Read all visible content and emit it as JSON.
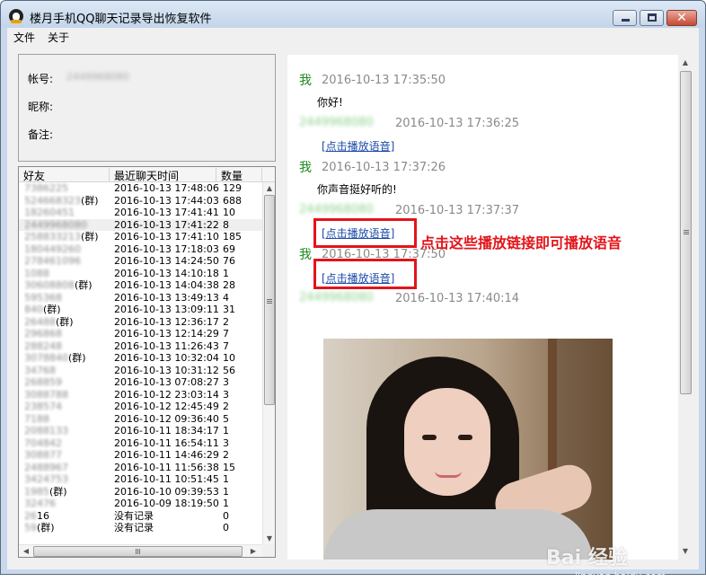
{
  "window": {
    "title": "楼月手机QQ聊天记录导出恢复软件"
  },
  "menu": {
    "file": "文件",
    "about": "关于"
  },
  "info": {
    "account_label": "帐号:",
    "account_value": "2449968080",
    "nickname_label": "昵称:",
    "note_label": "备注:"
  },
  "friends": {
    "headers": {
      "friend": "好友",
      "time": "最近聊天时间",
      "count": "数量"
    },
    "rows": [
      {
        "friend": "7386225",
        "group": "",
        "time": "2016-10-13 17:48:06",
        "count": "129"
      },
      {
        "friend": "524668323",
        "group": "(群)",
        "time": "2016-10-13 17:44:03",
        "count": "688"
      },
      {
        "friend": "18260451",
        "group": "",
        "time": "2016-10-13 17:41:41",
        "count": "10"
      },
      {
        "friend": "2449968080",
        "group": "",
        "time": "2016-10-13 17:41:22",
        "count": "8"
      },
      {
        "friend": "258833213",
        "group": "(群)",
        "time": "2016-10-13 17:41:10",
        "count": "185"
      },
      {
        "friend": "180449260",
        "group": "",
        "time": "2016-10-13 17:18:03",
        "count": "69"
      },
      {
        "friend": "278461096",
        "group": "",
        "time": "2016-10-13 14:24:50",
        "count": "76"
      },
      {
        "friend": "1088",
        "group": "",
        "time": "2016-10-13 14:10:18",
        "count": "1"
      },
      {
        "friend": "30608808",
        "group": "(群)",
        "time": "2016-10-13 14:04:38",
        "count": "28"
      },
      {
        "friend": "595368",
        "group": "",
        "time": "2016-10-13 13:49:13",
        "count": "4"
      },
      {
        "friend": "840",
        "group": "(群)",
        "time": "2016-10-13 13:09:11",
        "count": "31"
      },
      {
        "friend": "26488",
        "group": "(群)",
        "time": "2016-10-13 12:36:17",
        "count": "2"
      },
      {
        "friend": "296868",
        "group": "",
        "time": "2016-10-13 12:14:29",
        "count": "7"
      },
      {
        "friend": "288248",
        "group": "",
        "time": "2016-10-13 11:26:43",
        "count": "7"
      },
      {
        "friend": "3078840",
        "group": "(群)",
        "time": "2016-10-13 10:32:04",
        "count": "10"
      },
      {
        "friend": "34768",
        "group": "",
        "time": "2016-10-13 10:31:12",
        "count": "56"
      },
      {
        "friend": "268859",
        "group": "",
        "time": "2016-10-13 07:08:27",
        "count": "3"
      },
      {
        "friend": "3088788",
        "group": "",
        "time": "2016-10-12 23:03:14",
        "count": "3"
      },
      {
        "friend": "238574",
        "group": "",
        "time": "2016-10-12 12:45:49",
        "count": "2"
      },
      {
        "friend": "7188",
        "group": "",
        "time": "2016-10-12 09:36:40",
        "count": "5"
      },
      {
        "friend": "2088133",
        "group": "",
        "time": "2016-10-11 18:34:17",
        "count": "1"
      },
      {
        "friend": "704842",
        "group": "",
        "time": "2016-10-11 16:54:11",
        "count": "3"
      },
      {
        "friend": "308877",
        "group": "",
        "time": "2016-10-11 14:46:29",
        "count": "2"
      },
      {
        "friend": "2488967",
        "group": "",
        "time": "2016-10-11 11:56:38",
        "count": "15"
      },
      {
        "friend": "3424753",
        "group": "",
        "time": "2016-10-11 10:51:45",
        "count": "1"
      },
      {
        "friend": "1985",
        "group": "(群)",
        "time": "2016-10-10 09:39:53",
        "count": "1"
      },
      {
        "friend": "32476",
        "group": "",
        "time": "2016-10-09 18:19:50",
        "count": "1"
      },
      {
        "friend": "26",
        "group": "16",
        "time": "没有记录",
        "count": "0"
      },
      {
        "friend": "59",
        "group": "(群)",
        "time": "没有记录",
        "count": "0"
      }
    ]
  },
  "chat": {
    "messages": [
      {
        "sender": "我",
        "time": "2016-10-13 17:35:50",
        "body": "你好!"
      },
      {
        "sender": "2449968080",
        "time": "2016-10-13 17:36:25",
        "body": "[点击播放语音]"
      },
      {
        "sender": "我",
        "time": "2016-10-13 17:37:26",
        "body": "你声音挺好听的!"
      },
      {
        "sender": "2449968080",
        "time": "2016-10-13 17:37:37",
        "body": "[点击播放语音]"
      },
      {
        "sender": "我",
        "time": "2016-10-13 17:37:50",
        "body": "[点击播放语音]"
      },
      {
        "sender": "2449968080",
        "time": "2016-10-13 17:40:14",
        "body": ""
      }
    ],
    "annotation": "点击这些播放链接即可播放语音",
    "watermark": "Bai 经验",
    "watermark_sub": "jingyan.baidu.com"
  },
  "colors": {
    "accent_red": "#e3141a",
    "self_name": "#1c8a1c",
    "link": "#1a4aa8"
  }
}
